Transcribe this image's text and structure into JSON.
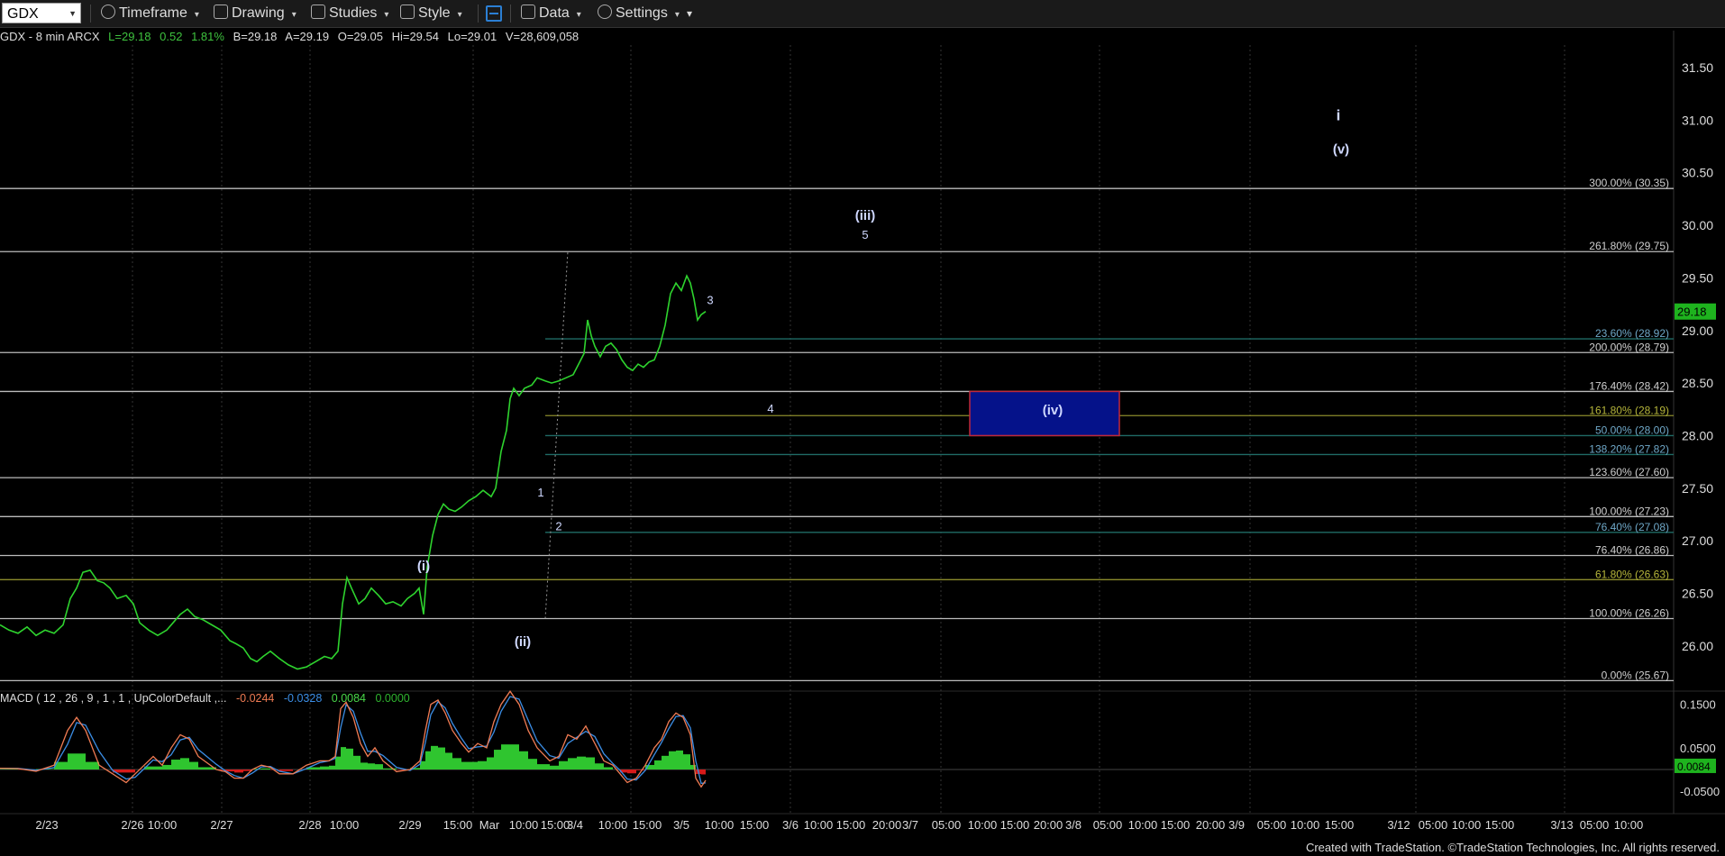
{
  "toolbar": {
    "symbol": "GDX",
    "timeframe": "Timeframe",
    "drawing": "Drawing",
    "studies": "Studies",
    "style": "Style",
    "data": "Data",
    "settings": "Settings"
  },
  "quote": {
    "header": "GDX - 8 min  ARCX",
    "last": "L=29.18",
    "change": "0.52",
    "change_pct": "1.81%",
    "bid": "B=29.18",
    "ask": "A=29.19",
    "open": "O=29.05",
    "high": "Hi=29.54",
    "low": "Lo=29.01",
    "volume": "V=28,609,058"
  },
  "macd_legend": {
    "label": "MACD ( 12 , 26 , 9 , 1 , 1 , UpColorDefault ,...",
    "v1": "-0.0244",
    "v2": "-0.0328",
    "v3": "0.0084",
    "v4": "0.0000",
    "c1": "#f07b53",
    "c2": "#3b8ee6",
    "c3": "#49d849",
    "c4": "#2fb52f"
  },
  "footer": "Created with TradeStation. ©TradeStation Technologies, Inc. All rights reserved.",
  "chart_data": {
    "type": "line",
    "title": "GDX - 8 min",
    "price_axis": {
      "ticks": [
        "31.50",
        "31.00",
        "30.50",
        "30.00",
        "29.50",
        "29.00",
        "28.50",
        "28.00",
        "27.50",
        "27.00",
        "26.50",
        "26.00"
      ],
      "ylim": [
        25.6,
        31.75
      ]
    },
    "last_price_tag": "29.18",
    "macd_axis": {
      "ticks": [
        "0.1500",
        "0.0500",
        "-0.0500"
      ],
      "current_tag": "0.0084"
    },
    "x_ticks": [
      "2/23",
      "2/26",
      "10:00",
      "2/27",
      "2/28",
      "10:00",
      "2/29",
      "15:00",
      "Mar",
      "10:00",
      "15:00",
      "3/4",
      "10:00",
      "15:00",
      "3/5",
      "10:00",
      "15:00",
      "3/6",
      "10:00",
      "15:00",
      "20:00",
      "3/7",
      "05:00",
      "10:00",
      "15:00",
      "20:00",
      "3/8",
      "05:00",
      "10:00",
      "15:00",
      "20:00",
      "3/9",
      "05:00",
      "10:00",
      "15:00",
      "3/12",
      "05:00",
      "10:00",
      "15:00",
      "3/13",
      "05:00",
      "10:00"
    ],
    "price_series": [
      [
        0,
        26.2
      ],
      [
        10,
        26.15
      ],
      [
        20,
        26.12
      ],
      [
        30,
        26.18
      ],
      [
        40,
        26.1
      ],
      [
        50,
        26.15
      ],
      [
        60,
        26.12
      ],
      [
        70,
        26.2
      ],
      [
        78,
        26.45
      ],
      [
        85,
        26.55
      ],
      [
        92,
        26.7
      ],
      [
        100,
        26.72
      ],
      [
        108,
        26.62
      ],
      [
        115,
        26.6
      ],
      [
        122,
        26.55
      ],
      [
        130,
        26.45
      ],
      [
        140,
        26.48
      ],
      [
        148,
        26.4
      ],
      [
        155,
        26.22
      ],
      [
        165,
        26.15
      ],
      [
        175,
        26.1
      ],
      [
        185,
        26.15
      ],
      [
        192,
        26.22
      ],
      [
        200,
        26.3
      ],
      [
        208,
        26.35
      ],
      [
        216,
        26.28
      ],
      [
        225,
        26.25
      ],
      [
        235,
        26.2
      ],
      [
        245,
        26.15
      ],
      [
        255,
        26.05
      ],
      [
        262,
        26.02
      ],
      [
        270,
        25.98
      ],
      [
        278,
        25.88
      ],
      [
        285,
        25.85
      ],
      [
        292,
        25.9
      ],
      [
        300,
        25.95
      ],
      [
        310,
        25.88
      ],
      [
        320,
        25.82
      ],
      [
        330,
        25.78
      ],
      [
        340,
        25.8
      ],
      [
        350,
        25.85
      ],
      [
        360,
        25.9
      ],
      [
        368,
        25.88
      ],
      [
        375,
        25.95
      ],
      [
        380,
        26.4
      ],
      [
        385,
        26.65
      ],
      [
        390,
        26.55
      ],
      [
        398,
        26.4
      ],
      [
        405,
        26.45
      ],
      [
        412,
        26.55
      ],
      [
        420,
        26.48
      ],
      [
        428,
        26.4
      ],
      [
        436,
        26.42
      ],
      [
        445,
        26.38
      ],
      [
        452,
        26.45
      ],
      [
        460,
        26.5
      ],
      [
        465,
        26.55
      ],
      [
        470,
        26.3
      ],
      [
        474,
        26.75
      ],
      [
        480,
        27.05
      ],
      [
        486,
        27.25
      ],
      [
        492,
        27.35
      ],
      [
        498,
        27.3
      ],
      [
        505,
        27.28
      ],
      [
        512,
        27.32
      ],
      [
        520,
        27.38
      ],
      [
        528,
        27.42
      ],
      [
        536,
        27.48
      ],
      [
        545,
        27.42
      ],
      [
        550,
        27.5
      ],
      [
        556,
        27.85
      ],
      [
        562,
        28.05
      ],
      [
        566,
        28.35
      ],
      [
        570,
        28.45
      ],
      [
        576,
        28.38
      ],
      [
        582,
        28.45
      ],
      [
        590,
        28.48
      ],
      [
        596,
        28.55
      ],
      [
        605,
        28.52
      ],
      [
        612,
        28.5
      ],
      [
        620,
        28.52
      ],
      [
        628,
        28.55
      ],
      [
        636,
        28.58
      ],
      [
        642,
        28.68
      ],
      [
        648,
        28.78
      ],
      [
        652,
        29.1
      ],
      [
        656,
        28.95
      ],
      [
        660,
        28.85
      ],
      [
        666,
        28.75
      ],
      [
        672,
        28.85
      ],
      [
        678,
        28.88
      ],
      [
        684,
        28.82
      ],
      [
        690,
        28.72
      ],
      [
        696,
        28.65
      ],
      [
        702,
        28.62
      ],
      [
        708,
        28.68
      ],
      [
        714,
        28.65
      ],
      [
        720,
        28.7
      ],
      [
        726,
        28.72
      ],
      [
        732,
        28.85
      ],
      [
        738,
        29.05
      ],
      [
        744,
        29.35
      ],
      [
        750,
        29.45
      ],
      [
        756,
        29.38
      ],
      [
        762,
        29.52
      ],
      [
        766,
        29.45
      ],
      [
        770,
        29.3
      ],
      [
        774,
        29.1
      ],
      [
        778,
        29.15
      ],
      [
        783,
        29.18
      ]
    ],
    "fib_levels_left_group": [
      {
        "label": "300.00% (30.35)",
        "value": 30.35
      },
      {
        "label": "261.80% (29.75)",
        "value": 29.75
      },
      {
        "label": "200.00% (28.79)",
        "value": 28.79
      },
      {
        "label": "176.40% (28.42)",
        "value": 28.42
      },
      {
        "label": "123.60% (27.60)",
        "value": 27.6
      },
      {
        "label": "100.00% (27.23)",
        "value": 27.23
      },
      {
        "label": "76.40% (26.86)",
        "value": 26.86
      },
      {
        "label": "61.80% (26.63)",
        "value": 26.63
      },
      {
        "label": "100.00% (26.26)",
        "value": 26.26
      },
      {
        "label": "0.00% (25.67)",
        "value": 25.67
      }
    ],
    "fib_levels_right_group": [
      {
        "label": "23.60% (28.92)",
        "value": 28.92
      },
      {
        "label": "161.80% (28.19)",
        "value": 28.19
      },
      {
        "label": "50.00% (28.00)",
        "value": 28.0
      },
      {
        "label": "138.20% (27.82)",
        "value": 27.82
      },
      {
        "label": "76.40% (27.08)",
        "value": 27.08
      }
    ],
    "wave_labels": [
      {
        "text": "(i)",
        "price": 26.72
      },
      {
        "text": "(ii)",
        "price": 26.0
      },
      {
        "text": "1",
        "price": 27.42
      },
      {
        "text": "2",
        "price": 27.1
      },
      {
        "text": "3",
        "price": 29.25
      },
      {
        "text": "4",
        "price": 28.22
      },
      {
        "text": "5",
        "price": 29.87
      },
      {
        "text": "(iii)",
        "price": 30.05
      },
      {
        "text": "(iv)",
        "price": 28.2
      },
      {
        "text": "(v)",
        "price": 30.68
      },
      {
        "text": "i",
        "price": 31.0
      }
    ],
    "target_box": {
      "top": 28.42,
      "bottom": 28.0
    },
    "macd_series": [
      [
        0,
        0.003
      ],
      [
        20,
        0.002
      ],
      [
        40,
        -0.004
      ],
      [
        60,
        0.01
      ],
      [
        75,
        0.09
      ],
      [
        85,
        0.12
      ],
      [
        95,
        0.09
      ],
      [
        110,
        0.01
      ],
      [
        125,
        -0.01
      ],
      [
        140,
        -0.03
      ],
      [
        150,
        -0.01
      ],
      [
        160,
        0.01
      ],
      [
        170,
        0.03
      ],
      [
        180,
        0.01
      ],
      [
        190,
        0.05
      ],
      [
        200,
        0.08
      ],
      [
        210,
        0.07
      ],
      [
        220,
        0.03
      ],
      [
        240,
        0.0
      ],
      [
        250,
        -0.005
      ],
      [
        260,
        -0.02
      ],
      [
        270,
        -0.02
      ],
      [
        280,
        0.0
      ],
      [
        290,
        0.01
      ],
      [
        300,
        0.005
      ],
      [
        310,
        -0.01
      ],
      [
        325,
        -0.01
      ],
      [
        340,
        0.01
      ],
      [
        355,
        0.02
      ],
      [
        365,
        0.02
      ],
      [
        372,
        0.03
      ],
      [
        378,
        0.14
      ],
      [
        384,
        0.155
      ],
      [
        392,
        0.12
      ],
      [
        400,
        0.06
      ],
      [
        408,
        0.03
      ],
      [
        416,
        0.05
      ],
      [
        425,
        0.02
      ],
      [
        440,
        -0.005
      ],
      [
        455,
        0.0
      ],
      [
        466,
        0.02
      ],
      [
        472,
        0.09
      ],
      [
        478,
        0.15
      ],
      [
        486,
        0.16
      ],
      [
        494,
        0.13
      ],
      [
        502,
        0.09
      ],
      [
        512,
        0.06
      ],
      [
        520,
        0.04
      ],
      [
        530,
        0.06
      ],
      [
        540,
        0.05
      ],
      [
        548,
        0.11
      ],
      [
        556,
        0.15
      ],
      [
        566,
        0.18
      ],
      [
        576,
        0.15
      ],
      [
        586,
        0.09
      ],
      [
        596,
        0.05
      ],
      [
        610,
        0.02
      ],
      [
        620,
        0.03
      ],
      [
        630,
        0.08
      ],
      [
        640,
        0.07
      ],
      [
        650,
        0.1
      ],
      [
        660,
        0.06
      ],
      [
        670,
        0.02
      ],
      [
        680,
        0.01
      ],
      [
        688,
        -0.01
      ],
      [
        696,
        -0.03
      ],
      [
        706,
        -0.02
      ],
      [
        716,
        0.01
      ],
      [
        726,
        0.05
      ],
      [
        734,
        0.07
      ],
      [
        742,
        0.11
      ],
      [
        750,
        0.13
      ],
      [
        758,
        0.12
      ],
      [
        766,
        0.08
      ],
      [
        772,
        -0.02
      ],
      [
        778,
        -0.04
      ],
      [
        783,
        -0.025
      ]
    ]
  }
}
